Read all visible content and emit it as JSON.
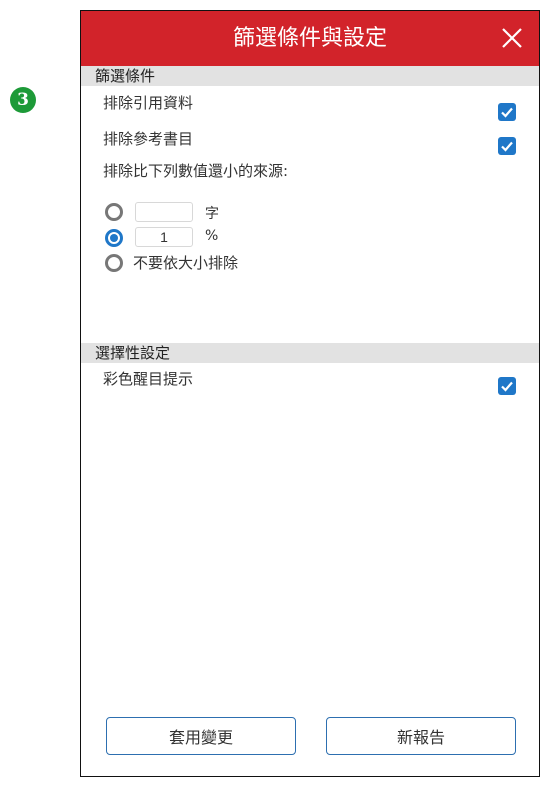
{
  "step_badge": "3",
  "header": {
    "title": "篩選條件與設定"
  },
  "filter_section": {
    "title": "篩選條件",
    "exclude_citations": {
      "label": "排除引用資料",
      "checked": true
    },
    "exclude_bibliography": {
      "label": "排除參考書目",
      "checked": true
    },
    "size_prompt": "排除比下列數值還小的來源:",
    "options": [
      {
        "value": "",
        "unit": "字",
        "selected": false
      },
      {
        "value": "1",
        "unit": "%",
        "selected": true
      },
      {
        "label": "不要依大小排除",
        "selected": false
      }
    ]
  },
  "optional_section": {
    "title": "選擇性設定",
    "color_highlight": {
      "label": "彩色醒目提示",
      "checked": true
    }
  },
  "buttons": {
    "apply": "套用變更",
    "new_report": "新報告"
  },
  "colors": {
    "header": "#d2232a",
    "accent": "#1f77c8",
    "badge": "#1d9a38"
  }
}
